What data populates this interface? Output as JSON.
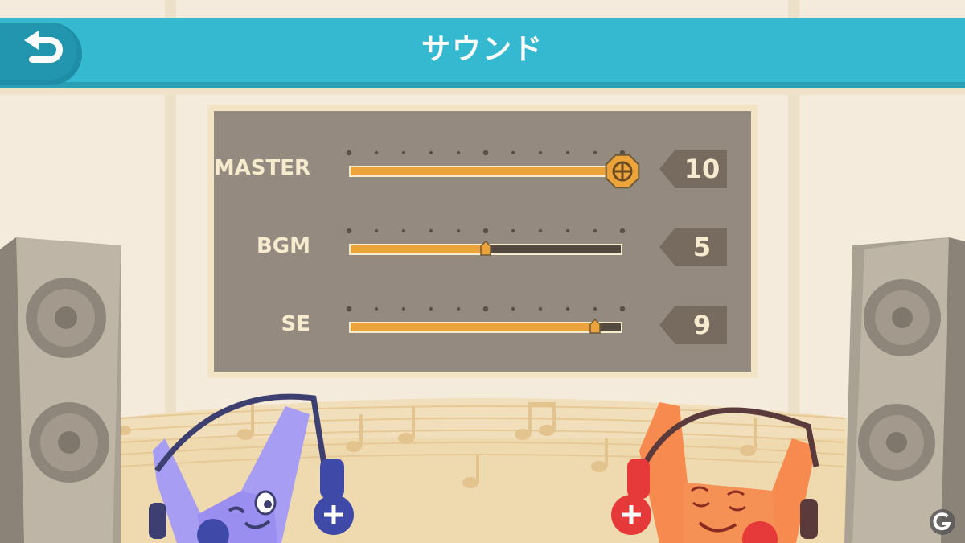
{
  "header": {
    "title": "サウンド",
    "back_icon": "back-arrow-icon"
  },
  "settings": [
    {
      "id": "master",
      "label": "MASTER",
      "value": 10,
      "max": 10
    },
    {
      "id": "bgm",
      "label": "BGM",
      "value": 5,
      "max": 10
    },
    {
      "id": "se",
      "label": "SE",
      "value": 9,
      "max": 10
    }
  ],
  "colors": {
    "header": "#34b9d1",
    "panel": "#958a7f",
    "slider_fill": "#eca43a",
    "slider_track": "#54493f",
    "label_text": "#f6ebcf"
  }
}
